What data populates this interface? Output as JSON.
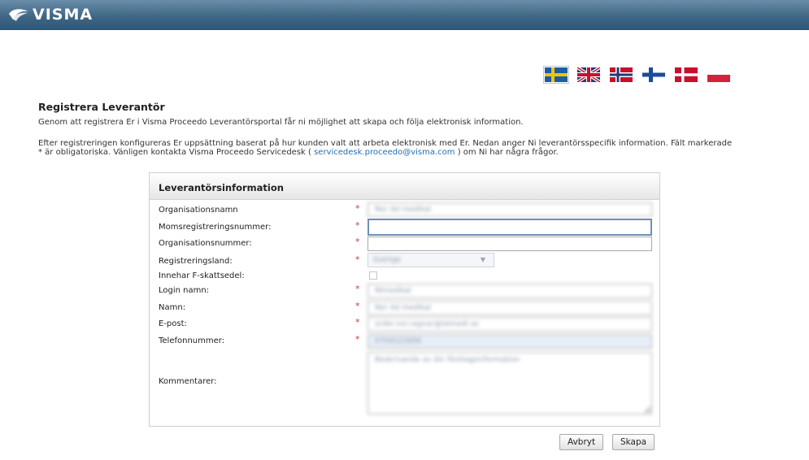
{
  "header": {
    "logo_text": "VISMA"
  },
  "languages": [
    {
      "name": "swedish",
      "selected": true
    },
    {
      "name": "english"
    },
    {
      "name": "norwegian"
    },
    {
      "name": "finnish"
    },
    {
      "name": "danish"
    },
    {
      "name": "polish"
    }
  ],
  "page": {
    "title": "Registrera Leverantör",
    "intro": "Genom att registrera Er i Visma Proceedo Leverantörsportal får ni möjlighet att skapa och följa elektronisk information.",
    "info_line1": "Efter registreringen konfigureras Er uppsättning baserat på hur kunden valt att arbeta elektronisk med Er. Nedan anger Ni leverantörsspecifik information. Fält markerade",
    "info_line2_pre": "* är obligatoriska. Vänligen kontakta Visma Proceedo Servicedesk (",
    "info_email": "servicedesk.proceedo@visma.com",
    "info_line2_post": ") om Ni har några frågor."
  },
  "form": {
    "section_title": "Leverantörsinformation",
    "required_mark": "*",
    "fields": {
      "organisationsnamn": {
        "label": "Organisationsnamn",
        "value": "Nor Ad medikal"
      },
      "momsnr": {
        "label": "Momsregistreringsnummer:",
        "value": ""
      },
      "orgnr": {
        "label": "Organisationsnummer:",
        "value": ""
      },
      "land": {
        "label": "Registreringsland:",
        "value": "Sverige"
      },
      "fskatt": {
        "label": "Innehar F-skattsedel:"
      },
      "login": {
        "label": "Login namn:",
        "value": "Nlmedikal"
      },
      "namn": {
        "label": "Namn:",
        "value": "Nor Ad medikal"
      },
      "epost": {
        "label": "E-post:",
        "value": "order.nor.ragnar@lalmedi.se"
      },
      "telefon": {
        "label": "Telefonnummer:",
        "value": "0704123456"
      },
      "kommentarer": {
        "label": "Kommentarer:",
        "value": "Beskrivande av din företagsinformation"
      }
    }
  },
  "actions": {
    "cancel": "Avbryt",
    "create": "Skapa"
  }
}
